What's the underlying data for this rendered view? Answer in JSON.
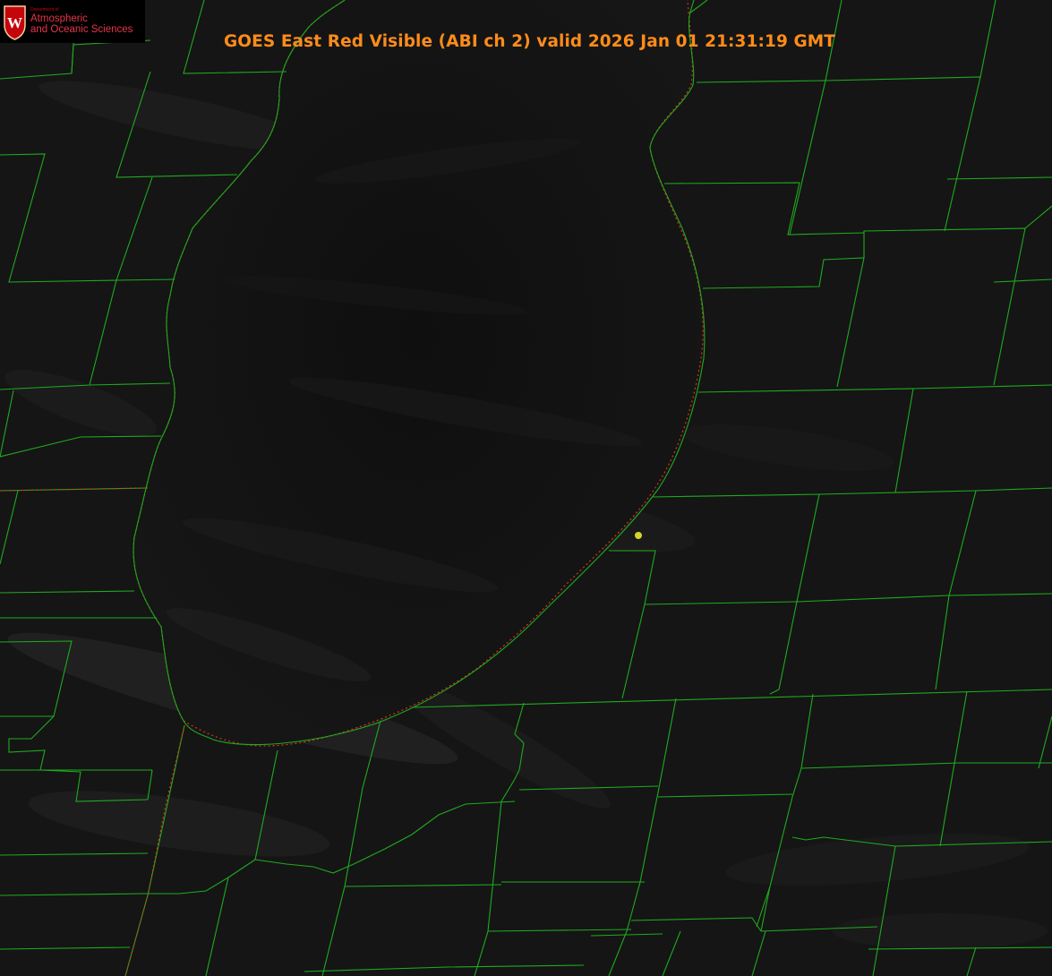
{
  "title": "GOES East Red Visible (ABI ch 2) valid 2026 Jan 01 21:31:19 GMT",
  "logo": {
    "department": "Department of",
    "line1": "Atmospheric",
    "line2": "and Oceanic Sciences",
    "crest_letter": "W"
  },
  "colors": {
    "county_lines": "#1faa1f",
    "state_lines": "#e0301e",
    "title": "#ff8c1a",
    "marker": "#d4d42a",
    "background": "#121212",
    "logo_red": "#c5050c"
  },
  "map": {
    "feature": "Lake Michigan (southern basin)",
    "marker_icon": "yellow-dot-icon"
  }
}
